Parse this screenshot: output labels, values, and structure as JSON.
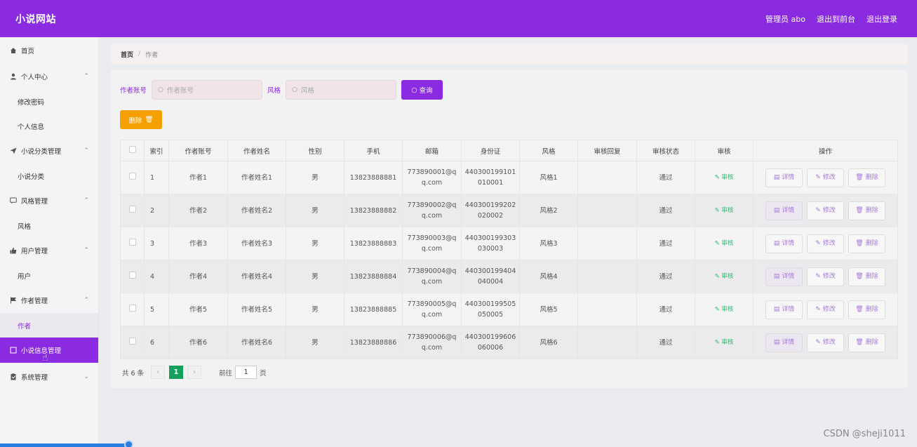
{
  "header": {
    "brand": "小说网站",
    "actions": [
      "管理员 abo",
      "退出到前台",
      "退出登录"
    ]
  },
  "sidebar": {
    "home": "首页",
    "personal": "个人中心",
    "personal_sub": [
      "修改密码",
      "个人信息"
    ],
    "category": "小说分类管理",
    "category_sub": [
      "小说分类"
    ],
    "style": "风格管理",
    "style_sub": [
      "风格"
    ],
    "user": "用户管理",
    "user_sub": [
      "用户"
    ],
    "author": "作者管理",
    "author_sub": [
      "作者"
    ],
    "novel_info": "小说信息管理",
    "system": "系统管理"
  },
  "breadcrumb": {
    "home": "首页",
    "sep": "/",
    "current": "作者"
  },
  "search": {
    "account_label": "作者账号",
    "account_placeholder": "作者账号",
    "style_label": "风格",
    "style_placeholder": "风格",
    "query_button": "查询"
  },
  "toolbar": {
    "delete_label": "删除"
  },
  "table": {
    "columns": [
      "索引",
      "作者账号",
      "作者姓名",
      "性别",
      "手机",
      "邮箱",
      "身份证",
      "风格",
      "审核回复",
      "审核状态",
      "审核",
      "操作"
    ],
    "rows": [
      {
        "index": "1",
        "account": "作者1",
        "name": "作者姓名1",
        "gender": "男",
        "phone": "13823888881",
        "email_a": "773890001@q",
        "email_b": "q.com",
        "id_a": "440300199101",
        "id_b": "010001",
        "style": "风格1",
        "reply": "",
        "status": "通过",
        "audit": "审核"
      },
      {
        "index": "2",
        "account": "作者2",
        "name": "作者姓名2",
        "gender": "男",
        "phone": "13823888882",
        "email_a": "773890002@q",
        "email_b": "q.com",
        "id_a": "440300199202",
        "id_b": "020002",
        "style": "风格2",
        "reply": "",
        "status": "通过",
        "audit": "审核"
      },
      {
        "index": "3",
        "account": "作者3",
        "name": "作者姓名3",
        "gender": "男",
        "phone": "13823888883",
        "email_a": "773890003@q",
        "email_b": "q.com",
        "id_a": "440300199303",
        "id_b": "030003",
        "style": "风格3",
        "reply": "",
        "status": "通过",
        "audit": "审核"
      },
      {
        "index": "4",
        "account": "作者4",
        "name": "作者姓名4",
        "gender": "男",
        "phone": "13823888884",
        "email_a": "773890004@q",
        "email_b": "q.com",
        "id_a": "440300199404",
        "id_b": "040004",
        "style": "风格4",
        "reply": "",
        "status": "通过",
        "audit": "审核"
      },
      {
        "index": "5",
        "account": "作者5",
        "name": "作者姓名5",
        "gender": "男",
        "phone": "13823888885",
        "email_a": "773890005@q",
        "email_b": "q.com",
        "id_a": "440300199505",
        "id_b": "050005",
        "style": "风格5",
        "reply": "",
        "status": "通过",
        "audit": "审核"
      },
      {
        "index": "6",
        "account": "作者6",
        "name": "作者姓名6",
        "gender": "男",
        "phone": "13823888886",
        "email_a": "773890006@q",
        "email_b": "q.com",
        "id_a": "440300199606",
        "id_b": "060006",
        "style": "风格6",
        "reply": "",
        "status": "通过",
        "audit": "审核"
      }
    ],
    "op_detail": "详情",
    "op_edit": "修改",
    "op_delete": "删除"
  },
  "pagination": {
    "total": "共 6 条",
    "prev": "‹",
    "current": "1",
    "next": "›",
    "goto_label": "前往",
    "goto_value": "1",
    "page_suffix": "页"
  },
  "watermark": "CSDN @sheji1011",
  "colors": {
    "accent": "#8a2be2",
    "warning": "#f5a000",
    "success": "#16a05d"
  }
}
